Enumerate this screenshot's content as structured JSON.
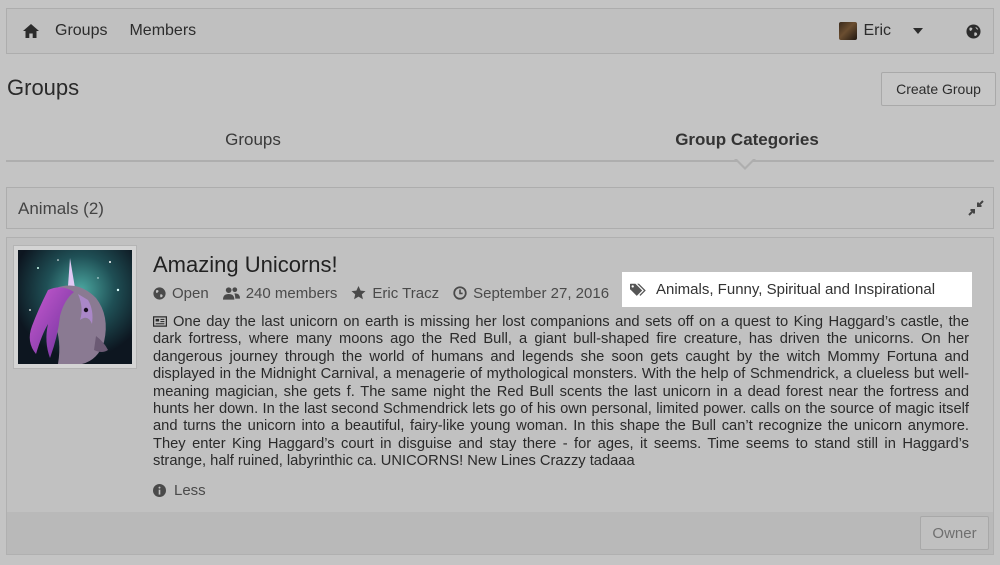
{
  "navbar": {
    "home_icon": "home-icon",
    "links": [
      "Groups",
      "Members"
    ],
    "user_name": "Eric",
    "globe_icon": "globe-icon"
  },
  "page": {
    "title": "Groups",
    "create_button": "Create Group"
  },
  "tabs": {
    "items": [
      "Groups",
      "Group Categories"
    ],
    "active": "Group Categories"
  },
  "category": {
    "title": "Animals (2)"
  },
  "group": {
    "title": "Amazing Unicorns!",
    "privacy": "Open",
    "members": "240 members",
    "owner_name": "Eric Tracz",
    "date": "September 27, 2016",
    "tags": "Animals, Funny, Spiritual and Inspirational",
    "description": "One day the last unicorn on earth is missing her lost companions and sets off on a quest to King Haggard’s castle, the dark fortress, where many moons ago the Red Bull, a giant bull-shaped fire creature, has driven the unicorns. On her dangerous journey through the world of humans and legends she soon gets caught by the witch Mommy Fortuna and displayed in the Midnight Carnival, a menagerie of mythological monsters. With the help of Schmendrick, a clueless but well-meaning magician, she gets f. The same night the Red Bull scents the last unicorn in a dead forest near the fortress and hunts her down. In the last second Schmendrick lets go of his own personal, limited power. calls on the source of magic itself and turns the unicorn into a beautiful, fairy-like young woman. In this shape the Bull can’t recognize the unicorn anymore. They enter King Haggard’s court in disguise and stay there - for ages, it seems. Time seems to stand still in Haggard’s strange, half ruined, labyrinthic ca. UNICORNS! New Lines Crazzy tadaaa",
    "less_label": "Less",
    "role_button": "Owner"
  },
  "colors": {
    "overlay": "#c4c4c4",
    "highlight": "#ffffff"
  }
}
